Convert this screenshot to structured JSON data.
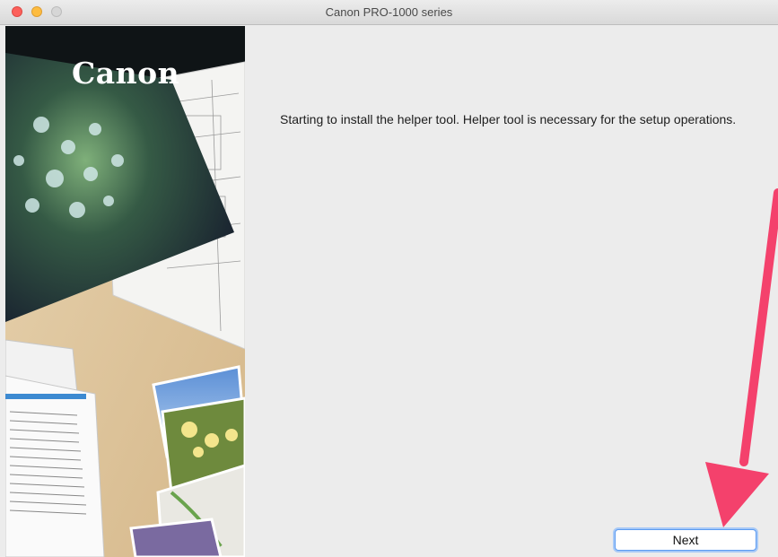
{
  "window": {
    "title": "Canon PRO-1000 series"
  },
  "sidebar": {
    "brand": "Canon"
  },
  "main": {
    "message": "Starting to install the helper tool. Helper tool is necessary for the setup operations.",
    "next_label": "Next"
  },
  "colors": {
    "annotation_arrow": "#f4416c",
    "focus_ring": "#5b9bf1"
  },
  "icons": [
    "close-icon",
    "minimize-icon",
    "zoom-icon",
    "annotation-arrow-icon"
  ]
}
